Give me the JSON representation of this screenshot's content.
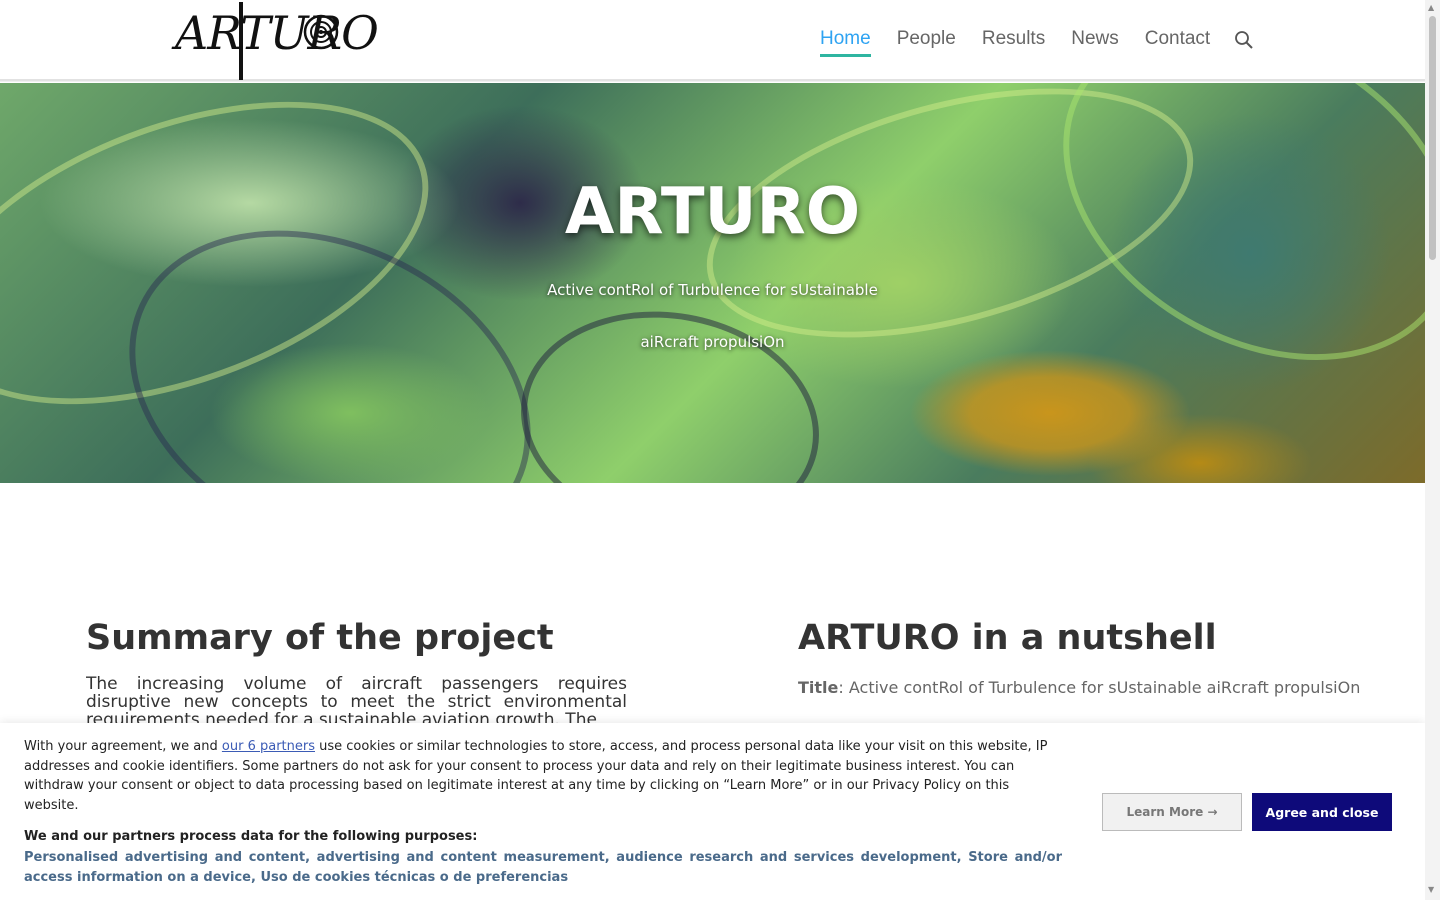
{
  "header": {
    "logo_text": "ARTURO",
    "nav": [
      {
        "label": "Home",
        "active": true
      },
      {
        "label": "People",
        "active": false
      },
      {
        "label": "Results",
        "active": false
      },
      {
        "label": "News",
        "active": false
      },
      {
        "label": "Contact",
        "active": false
      }
    ],
    "search_icon": "search-icon"
  },
  "hero": {
    "title": "ARTURO",
    "subtitle_line1": "Active contRol of Turbulence for sUstainable",
    "subtitle_line2": "aiRcraft propulsiOn"
  },
  "summary": {
    "title": "Summary of the project",
    "text": "The increasing volume of aircraft passengers requires disruptive new concepts to meet the strict environmental requirements needed for a sustainable aviation growth. The"
  },
  "nutshell": {
    "title": "ARTURO in a nutshell",
    "label": "Title",
    "value": ": Active contRol of Turbulence for sUstainable aiRcraft propulsiOn"
  },
  "cookie": {
    "text_before_link": "With your agreement, we and ",
    "link": "our 6 partners",
    "text_after_link": " use cookies or similar technologies to store, access, and process personal data like your visit on this website, IP addresses and cookie identifiers. Some partners do not ask for your consent to process your data and rely on their legitimate business interest. You can withdraw your consent or object to data processing based on legitimate interest at any time by clicking on “Learn More” or in our Privacy Policy on this website.",
    "purposes_title": "We and our partners process data for the following purposes:",
    "purposes": "Personalised advertising and content, advertising and content measurement, audience research and services development, Store and/or access information on a device, Uso de cookies técnicas o de preferencias",
    "learn_more": "Learn More →",
    "agree": "Agree and close"
  },
  "colors": {
    "accent": "#2ea3f2",
    "underline": "#2fb5a1",
    "agree_button": "#0e0a7a"
  }
}
